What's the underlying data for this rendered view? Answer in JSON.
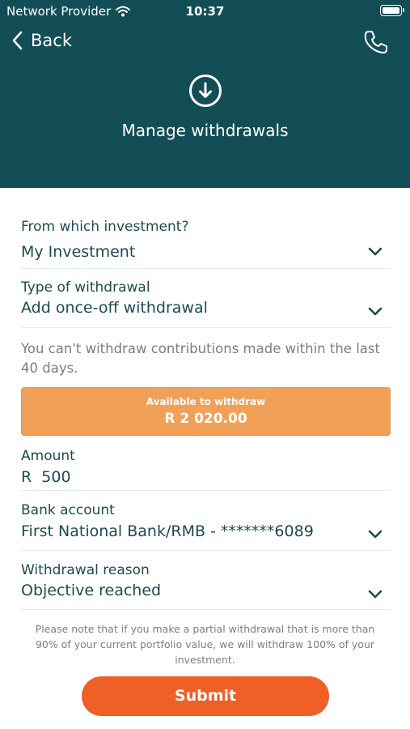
{
  "status_bar": {
    "carrier": "Network Provider",
    "time": "10:37",
    "wifi_icon": "wifi-icon",
    "battery_icon": "battery-icon"
  },
  "nav": {
    "back_label": "Back",
    "back_icon": "chevron-left-icon",
    "call_icon": "phone-icon"
  },
  "header": {
    "icon": "download-circle-icon",
    "title": "Manage withdrawals"
  },
  "form": {
    "investment": {
      "label": "From which investment?",
      "value": "My Investment"
    },
    "withdrawal_type": {
      "label": "Type of withdrawal",
      "value": "Add once-off withdrawal"
    },
    "note": "You can't withdraw contributions made within the last 40 days.",
    "available": {
      "label": "Available to withdraw",
      "value": "R 2 020.00"
    },
    "amount": {
      "label": "Amount",
      "value": "R  500"
    },
    "bank_account": {
      "label": "Bank account",
      "value": "First National Bank/RMB - *******6089"
    },
    "reason": {
      "label": "Withdrawal reason",
      "value": "Objective reached"
    }
  },
  "disclaimer": "Please note that if you make a partial withdrawal that is more than 90% of your current portfolio value, we will withdraw 100% of your investment.",
  "submit_label": "Submit",
  "colors": {
    "header_bg": "#134e57",
    "available_bg": "#f1a058",
    "submit_bg": "#ef5f26",
    "text": "#1f4a50"
  }
}
